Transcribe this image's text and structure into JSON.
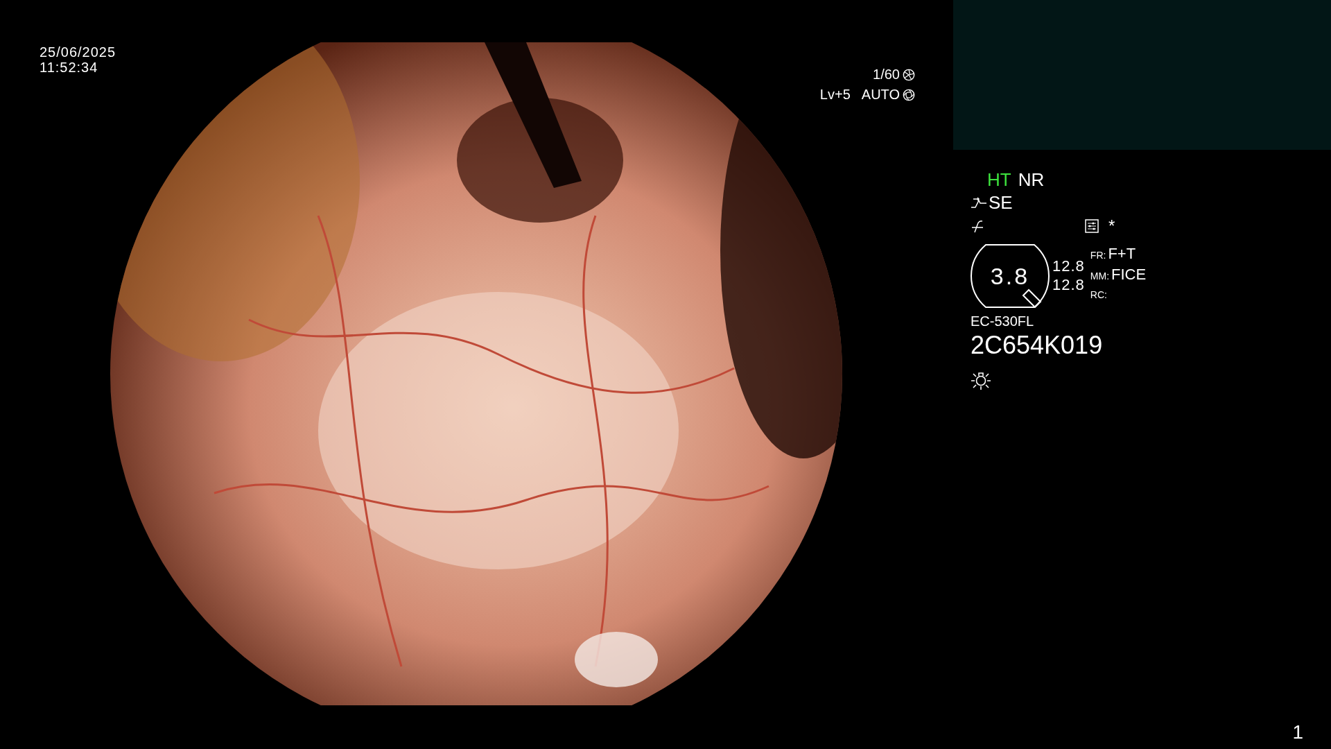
{
  "datetime": {
    "date": "25/06/2025",
    "time": "11:52:34"
  },
  "exposure": {
    "shutter": "1/60",
    "level": "Lv+5",
    "mode": "AUTO"
  },
  "status": {
    "modes": [
      {
        "label": "HT",
        "on": true
      },
      {
        "label": "NR",
        "on": false
      }
    ],
    "enhancement": "SE",
    "asterisk": "*",
    "zoom_value": "3.8",
    "readings": [
      "12.8",
      "12.8"
    ],
    "settings": [
      {
        "key": "FR:",
        "value": "F+T"
      },
      {
        "key": "MM:",
        "value": "FICE"
      },
      {
        "key": "RC:"
      }
    ],
    "scope_model": "EC-530FL",
    "serial": "2C654K019"
  },
  "page_number": "1"
}
